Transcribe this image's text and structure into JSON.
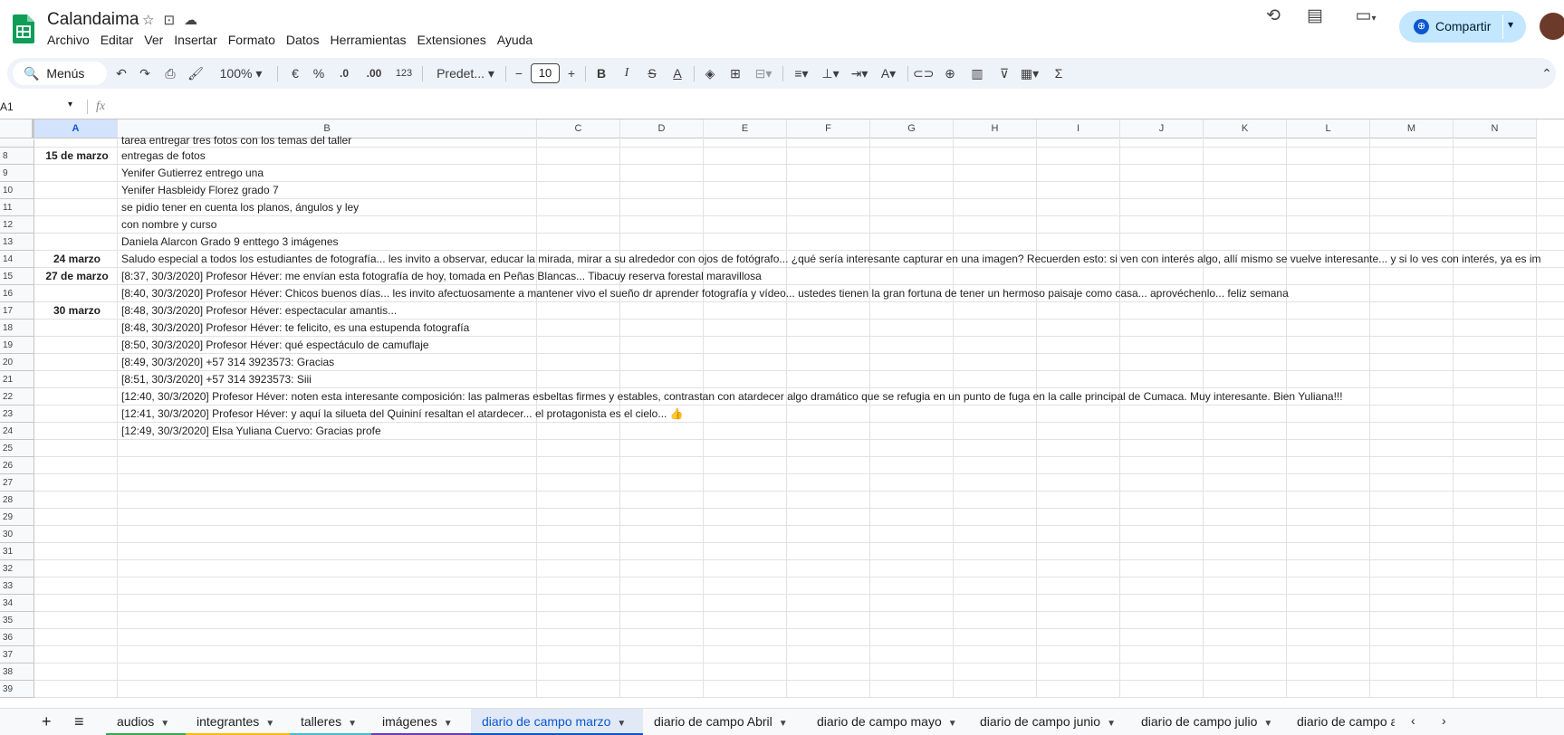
{
  "app": {
    "title": "Calandaima",
    "menu": [
      "Archivo",
      "Editar",
      "Ver",
      "Insertar",
      "Formato",
      "Datos",
      "Herramientas",
      "Extensiones",
      "Ayuda"
    ],
    "share_label": "Compartir"
  },
  "toolbar": {
    "search_label": "Menús",
    "zoom": "100%",
    "currency": "€",
    "percent": "%",
    "dec_decrease": ".0",
    "dec_increase": ".00",
    "number_format": "123",
    "font": "Predet...",
    "font_size": "10",
    "bold": "B",
    "italic": "I",
    "sum": "Σ"
  },
  "formula_bar": {
    "cell_ref": "A1",
    "fx": "fx"
  },
  "columns": [
    "A",
    "B",
    "C",
    "D",
    "E",
    "F",
    "G",
    "H",
    "I",
    "J",
    "K",
    "L",
    "M",
    "N"
  ],
  "rows": [
    {
      "num": "",
      "a": "",
      "b": "tarea entregar tres fotos con los temas del taller"
    },
    {
      "num": "8",
      "a": "15 de marzo",
      "b": "entregas de fotos"
    },
    {
      "num": "9",
      "a": "",
      "b": "Yenifer Gutierrez entrego una"
    },
    {
      "num": "10",
      "a": "",
      "b": "Yenifer Hasbleidy Florez grado 7"
    },
    {
      "num": "11",
      "a": "",
      "b": "se pidio tener en cuenta los planos, ángulos y ley"
    },
    {
      "num": "12",
      "a": "",
      "b": "con nombre y curso"
    },
    {
      "num": "13",
      "a": "",
      "b": "Daniela Alarcon Grado 9 enttego 3 imágenes"
    },
    {
      "num": "14",
      "a": "24 marzo",
      "b": "Saludo especial a todos los estudiantes de fotografía... les invito a observar, educar la mirada, mirar a su alrededor con ojos de fotógrafo... ¿qué sería interesante capturar en una imagen? Recuerden esto: si ven con interés algo, allí mismo se vuelve interesante... y si lo ves con interés, ya es im"
    },
    {
      "num": "15",
      "a": "27 de marzo",
      "b": "[8:37, 30/3/2020] Profesor Héver: me envían esta fotografía de hoy, tomada en Peñas Blancas... Tibacuy reserva forestal maravillosa"
    },
    {
      "num": "16",
      "a": "",
      "b": "[8:40, 30/3/2020] Profesor Héver: Chicos buenos días... les invito afectuosamente a mantener vivo el sueño dr aprender fotografía y vídeo... ustedes tienen la gran fortuna de tener un hermoso paisaje como casa... aprovéchenlo... feliz semana"
    },
    {
      "num": "17",
      "a": "30 marzo",
      "b": "[8:48, 30/3/2020] Profesor Héver: espectacular amantis..."
    },
    {
      "num": "18",
      "a": "",
      "b": "[8:48, 30/3/2020] Profesor Héver: te felicito,  es una estupenda fotografía"
    },
    {
      "num": "19",
      "a": "",
      "b": "[8:50, 30/3/2020] Profesor Héver: qué espectáculo de camuflaje"
    },
    {
      "num": "20",
      "a": "",
      "b": "[8:49, 30/3/2020] +57 314 3923573: Gracias"
    },
    {
      "num": "21",
      "a": "",
      "b": "[8:51, 30/3/2020] +57 314 3923573: Siii"
    },
    {
      "num": "22",
      "a": "",
      "b": "[12:40, 30/3/2020] Profesor Héver: noten esta interesante composición: las palmeras esbeltas firmes y estables, contrastan con atardecer algo dramático que se refugia en un punto de fuga en la calle principal de Cumaca. Muy interesante. Bien Yuliana!!!"
    },
    {
      "num": "23",
      "a": "",
      "b": "[12:41, 30/3/2020] Profesor Héver: y aquí la silueta del Quininí resaltan el atardecer... el protagonista es el cielo... 👍"
    },
    {
      "num": "24",
      "a": "",
      "b": "[12:49, 30/3/2020] Elsa Yuliana Cuervo: Gracias profe"
    },
    {
      "num": "25",
      "a": "",
      "b": ""
    },
    {
      "num": "26",
      "a": "",
      "b": ""
    },
    {
      "num": "27",
      "a": "",
      "b": ""
    },
    {
      "num": "28",
      "a": "",
      "b": ""
    },
    {
      "num": "29",
      "a": "",
      "b": ""
    },
    {
      "num": "30",
      "a": "",
      "b": ""
    },
    {
      "num": "31",
      "a": "",
      "b": ""
    },
    {
      "num": "32",
      "a": "",
      "b": ""
    },
    {
      "num": "33",
      "a": "",
      "b": ""
    },
    {
      "num": "34",
      "a": "",
      "b": ""
    },
    {
      "num": "35",
      "a": "",
      "b": ""
    },
    {
      "num": "36",
      "a": "",
      "b": ""
    },
    {
      "num": "37",
      "a": "",
      "b": ""
    },
    {
      "num": "38",
      "a": "",
      "b": ""
    },
    {
      "num": "39",
      "a": "",
      "b": ""
    }
  ],
  "sheets": [
    {
      "label": "audios",
      "color": "#34a853"
    },
    {
      "label": "integrantes",
      "color": "#fbbc04"
    },
    {
      "label": "talleres",
      "color": "#46bdc6"
    },
    {
      "label": "imágenes",
      "color": "#673ab7"
    },
    {
      "label": "diario de campo marzo",
      "color": "#0b57d0",
      "active": true
    },
    {
      "label": "diario de campo Abril",
      "color": ""
    },
    {
      "label": "diario de campo mayo",
      "color": ""
    },
    {
      "label": "diario de campo junio",
      "color": ""
    },
    {
      "label": "diario de campo julio",
      "color": ""
    },
    {
      "label": "diario de campo a",
      "color": ""
    }
  ],
  "icons": {
    "star": "star-icon",
    "move": "folder-move-icon",
    "cloud": "cloud-status-icon",
    "history": "history-icon",
    "comments": "comments-icon",
    "meet": "meet-icon",
    "globe": "globe-icon"
  }
}
